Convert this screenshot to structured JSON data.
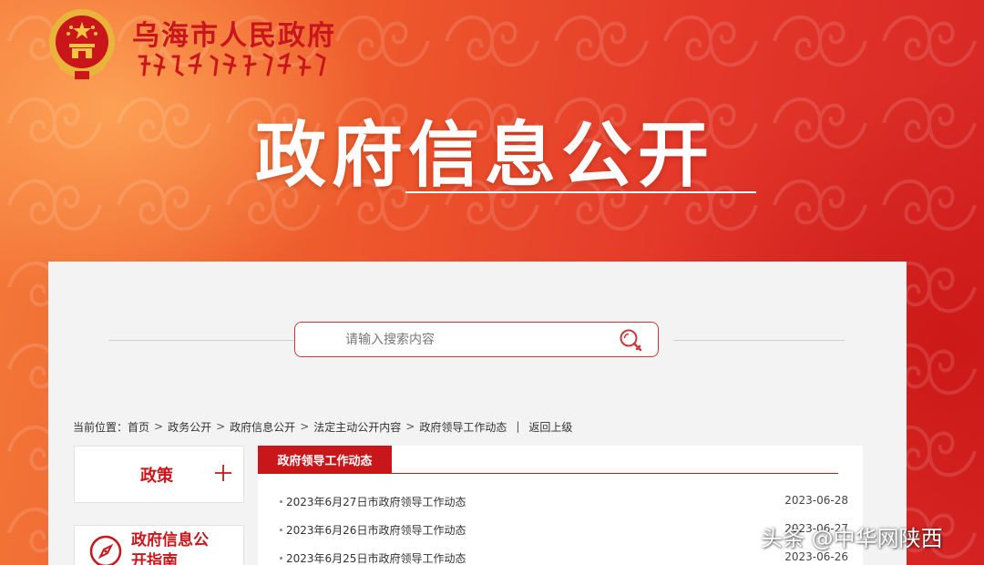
{
  "site": {
    "name": "乌海市人民政府",
    "script_text": "ᠦᠬᠠᠢ ᠬᠣᠲᠠ"
  },
  "hero": {
    "title": "政府信息公开"
  },
  "search": {
    "placeholder": "请输入搜索内容",
    "button_icon": "search-icon"
  },
  "breadcrumb": {
    "prefix": "当前位置：",
    "items": [
      "首页",
      "政务公开",
      "政府信息公开",
      "法定主动公开内容",
      "政府领导工作动态"
    ],
    "separator": ">",
    "back": "返回上级"
  },
  "sidebar": {
    "policy": {
      "label": "政策",
      "icon": "plus-icon"
    },
    "guide": {
      "label": "政府信息公开指南",
      "icon": "compass-icon"
    }
  },
  "content": {
    "tab": "政府领导工作动态",
    "items": [
      {
        "title": "2023年6月27日市政府领导工作动态",
        "date": "2023-06-28"
      },
      {
        "title": "2023年6月26日市政府领导工作动态",
        "date": "2023-06-27"
      },
      {
        "title": "2023年6月25日市政府领导工作动态",
        "date": "2023-06-26"
      }
    ]
  },
  "watermark": {
    "text": "头条 @中华网陕西"
  },
  "colors": {
    "brand_red": "#c8161a",
    "banner_orange": "#f47a3a",
    "panel_bg": "#f3f3f3"
  }
}
